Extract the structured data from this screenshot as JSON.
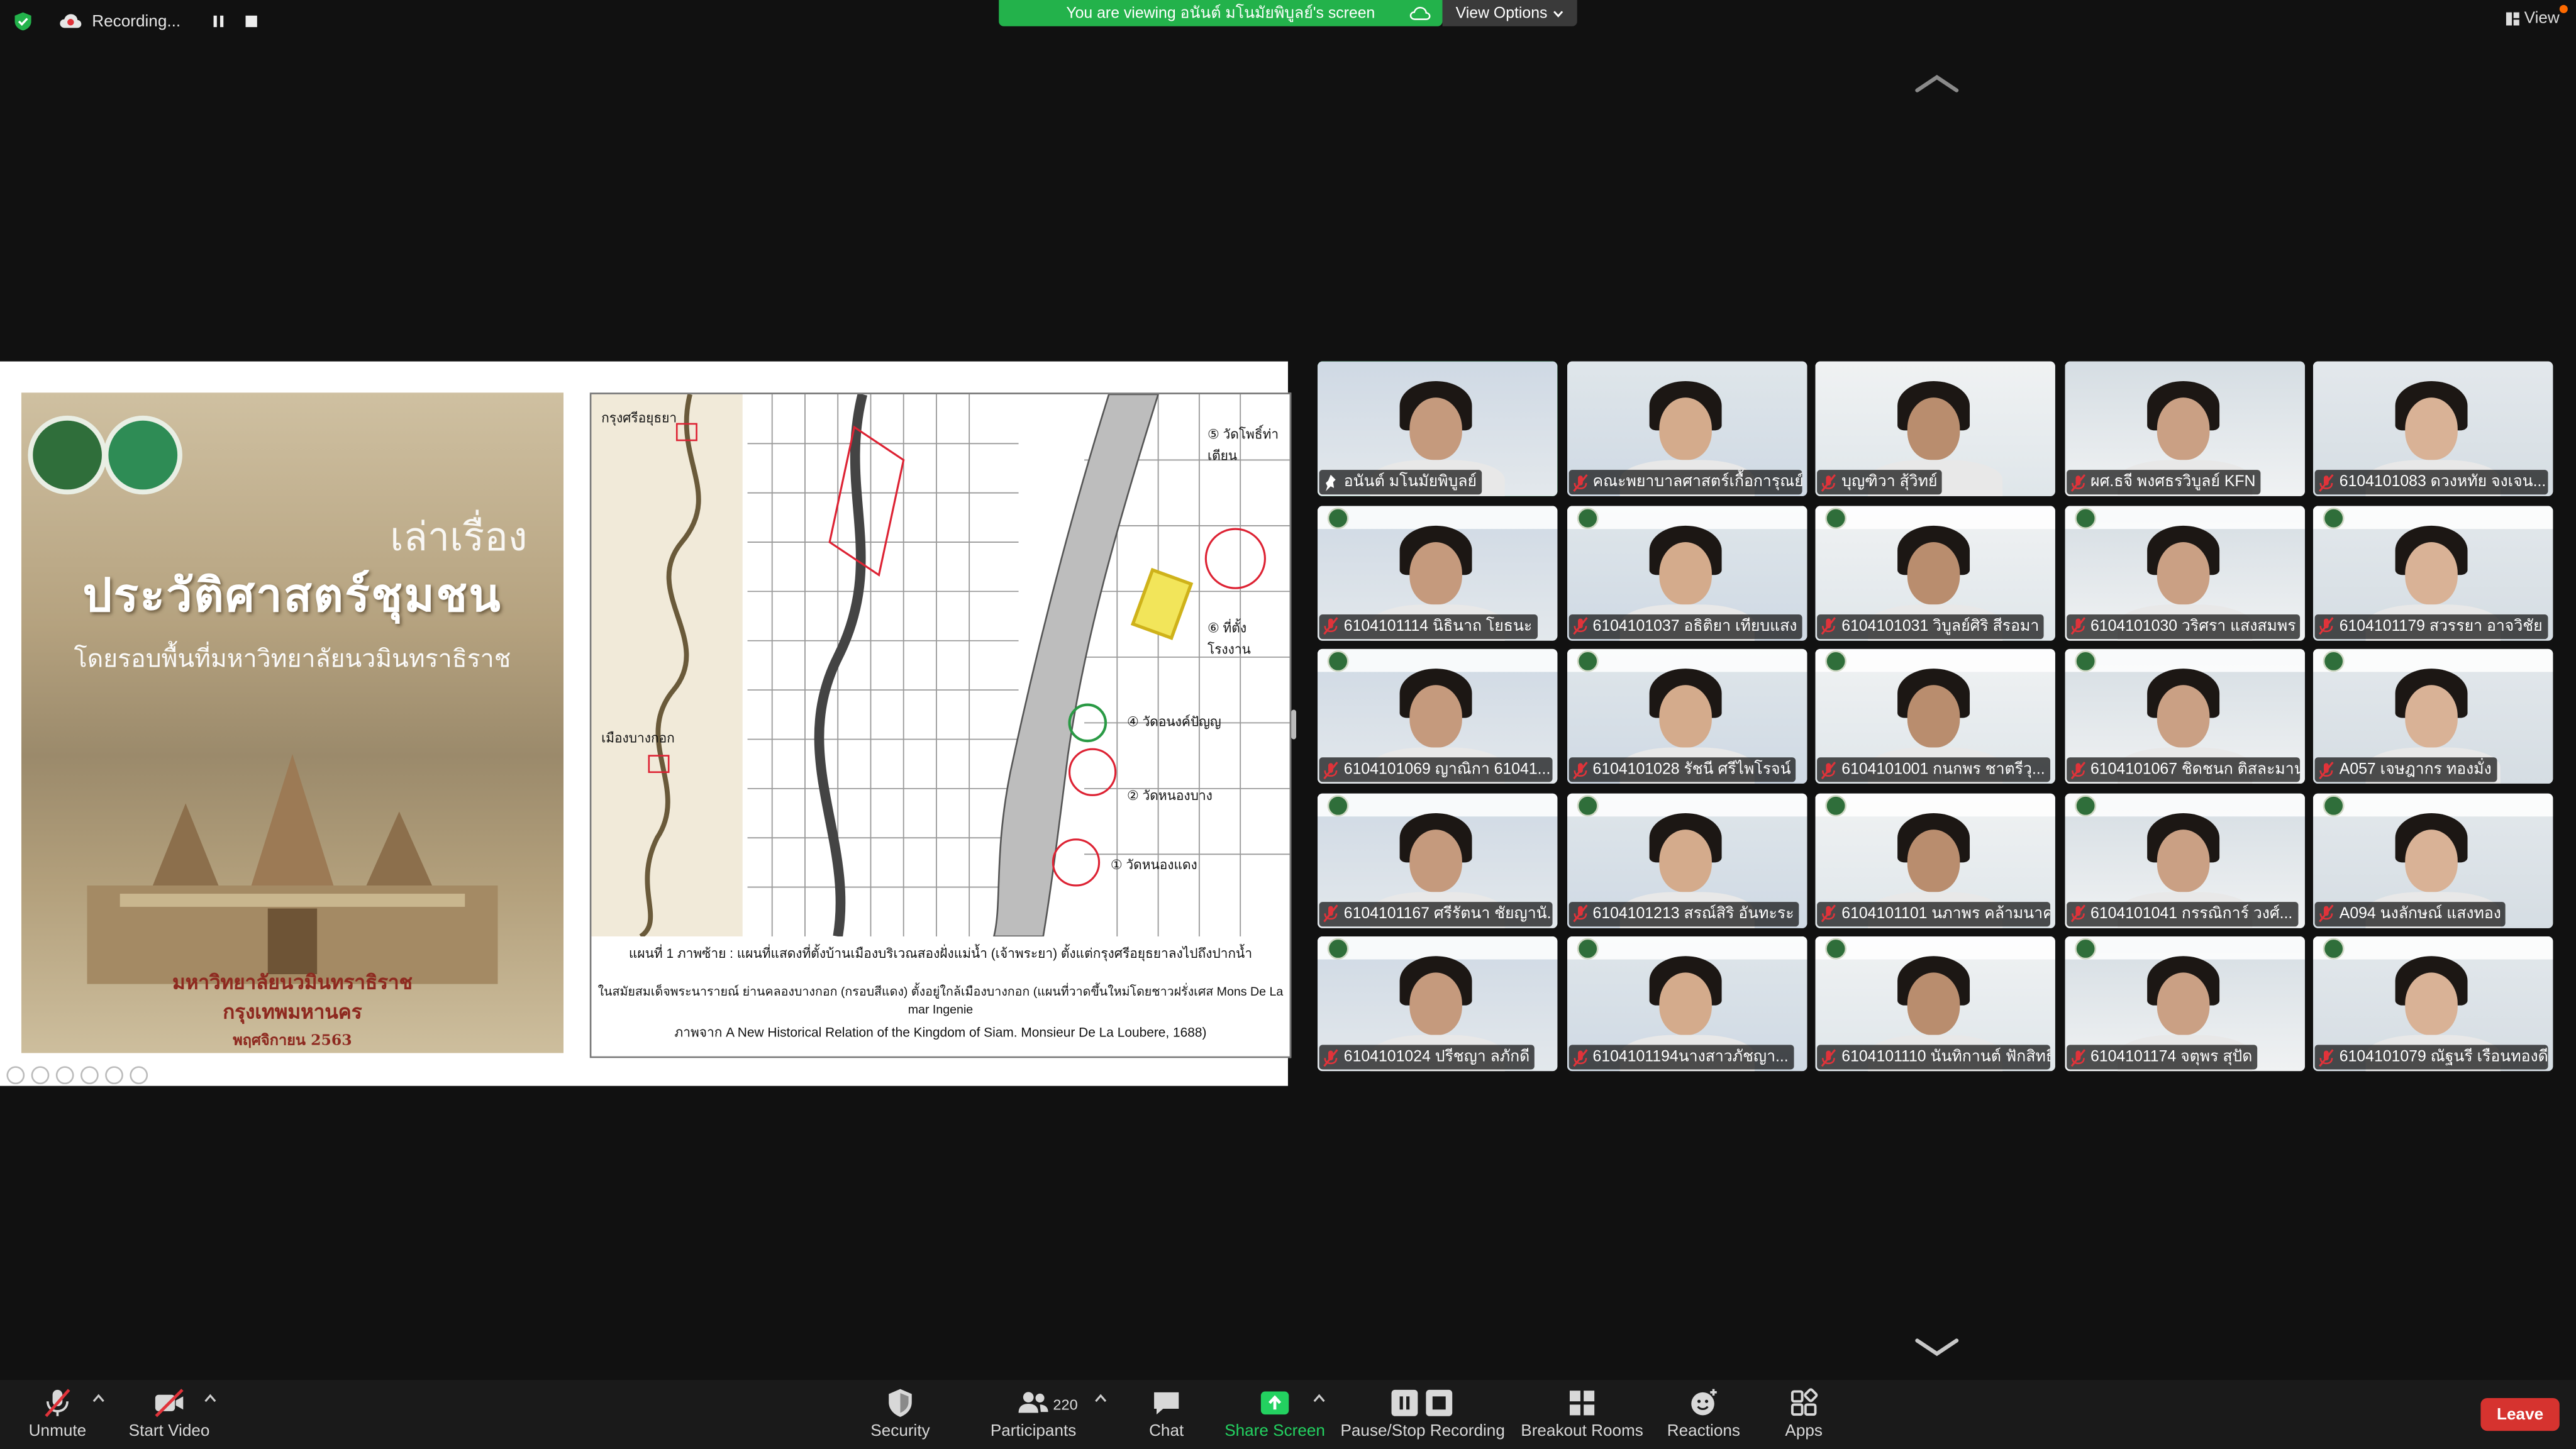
{
  "top_bar": {
    "recording_label": "Recording...",
    "banner_text": "You are viewing อนันต์ มโนมัยพิบูลย์'s screen",
    "view_options_label": "View Options",
    "view_label": "View"
  },
  "shared_screen": {
    "book": {
      "title_small": "เล่าเรื่อง",
      "title_main": "ประวัติศาสตร์ชุมชน",
      "subtitle": "โดยรอบพื้นที่มหาวิทยาลัยนวมินทราธิราช",
      "publisher_line1": "มหาวิทยาลัยนวมินทราธิราช",
      "publisher_line2": "กรุงเทพมหานคร",
      "date": "พฤศจิกายน 2563"
    },
    "map": {
      "label_top_left": "กรุงศรีอยุธยา",
      "label_bangkok": "เมืองบางกอก",
      "label_5": "⑤ วัดโพธิ์ท่าเตียน",
      "label_6": "⑥ ที่ตั้งโรงงาน",
      "label_4": "④ วัดอนงค์ปัญญ",
      "label_2": "② วัดหนองบาง",
      "label_1": "① วัดหนองแดง",
      "caption_1": "แผนที่ 1 ภาพซ้าย : แผนที่แสดงที่ตั้งบ้านเมืองบริเวณสองฝั่งแม่น้ำ (เจ้าพระยา) ตั้งแต่กรุงศรีอยุธยาลงไปถึงปากน้ำ",
      "caption_2": "ในสมัยสมเด็จพระนารายณ์ ย่านคลองบางกอก (กรอบสีแดง) ตั้งอยู่ใกล้เมืองบางกอก (แผนที่วาดขึ้นใหม่โดยชาวฝรั่งเศส Mons De La mar Ingenie",
      "caption_3": "ภาพจาก A New Historical Relation of the Kingdom of Siam. Monsieur De La Loubere, 1688)"
    }
  },
  "participants_gallery": [
    {
      "name": "อนันต์ มโนมัยพิบูลย์",
      "muted": false,
      "speaking": true
    },
    {
      "name": "คณะพยาบาลศาสตร์เกื้อการุณย์...",
      "muted": true
    },
    {
      "name": "บุญฑิวา สุ้วิทย์",
      "muted": true
    },
    {
      "name": "ผศ.ธจี พงศธรวิบูลย์ KFN",
      "muted": true
    },
    {
      "name": "6104101083 ดวงหทัย จงเจน...",
      "muted": true
    },
    {
      "name": "6104101114 นิธินาถ โยธนะ",
      "muted": true
    },
    {
      "name": "6104101037 อธิติยา เทียบแสง",
      "muted": true
    },
    {
      "name": "6104101031 วิบูลย์ศิริ สีรอมา",
      "muted": true
    },
    {
      "name": "6104101030 วริศรา แสงสมพร",
      "muted": true
    },
    {
      "name": "6104101179 สวรรยา อาจวิชัย",
      "muted": true
    },
    {
      "name": "6104101069 ญาณิกา 61041...",
      "muted": true
    },
    {
      "name": "6104101028 รัชนี ศรีไพโรจน์",
      "muted": true
    },
    {
      "name": "6104101001 กนกพร ชาตรีวุ...",
      "muted": true
    },
    {
      "name": "6104101067 ชิดชนก ติสละมาน",
      "muted": true
    },
    {
      "name": "A057 เจษฎากร ทองมั่ง",
      "muted": true
    },
    {
      "name": "6104101167 ศรีรัตนา ชัยญานั...",
      "muted": true
    },
    {
      "name": "6104101213 สรณ์สิริ อันทะระ",
      "muted": true
    },
    {
      "name": "6104101101 นภาพร คล้ามนาค",
      "muted": true
    },
    {
      "name": "6104101041 กรรณิการ์ วงศ์...",
      "muted": true
    },
    {
      "name": "A094 นงลักษณ์ แสงทอง",
      "muted": true
    },
    {
      "name": "6104101024 ปรีชญา ลภักดี",
      "muted": true
    },
    {
      "name": "6104101194นางสาวภัชญา...",
      "muted": true
    },
    {
      "name": "6104101110 นันทิกานต์ ฟักสิทธิ์",
      "muted": true
    },
    {
      "name": "6104101174 จตุพร สุปัด",
      "muted": true
    },
    {
      "name": "6104101079 ณัฐนรี เรือนทองดี",
      "muted": true
    }
  ],
  "toolbar": {
    "unmute": "Unmute",
    "start_video": "Start Video",
    "security": "Security",
    "participants": "Participants",
    "participant_count": "220",
    "chat": "Chat",
    "share_screen": "Share Screen",
    "pause_stop_recording": "Pause/Stop Recording",
    "breakout_rooms": "Breakout Rooms",
    "reactions": "Reactions",
    "apps": "Apps",
    "leave": "Leave"
  },
  "colors": {
    "background": "#111111",
    "banner_green": "#23b24b",
    "speaker_outline": "#23d160",
    "leave_red": "#d6332f",
    "muted_icon_red": "#e0333a"
  }
}
